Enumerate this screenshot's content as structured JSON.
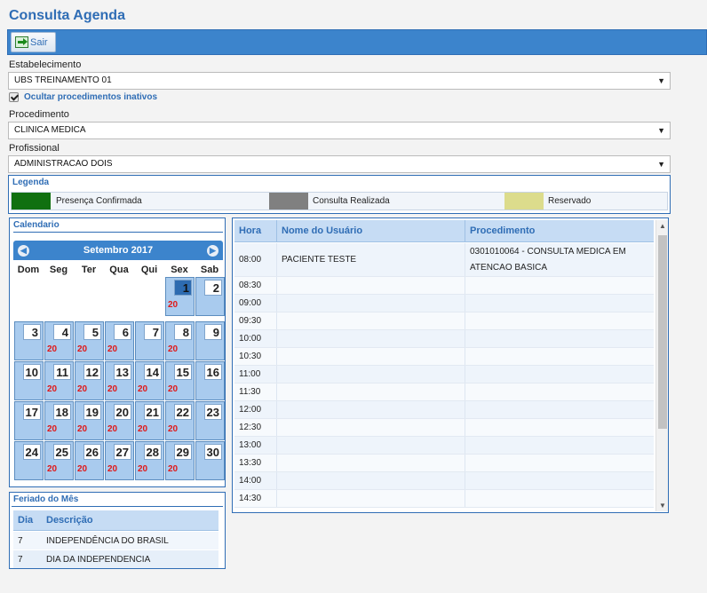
{
  "page": {
    "title": "Consulta Agenda"
  },
  "toolbar": {
    "exit_label": "Sair"
  },
  "form": {
    "establishment_label": "Estabelecimento",
    "establishment_value": "UBS TREINAMENTO 01",
    "hide_inactive_label": "Ocultar procedimentos inativos",
    "procedure_label": "Procedimento",
    "procedure_value": "CLINICA MEDICA",
    "professional_label": "Profissional",
    "professional_value": "ADMINISTRACAO DOIS"
  },
  "legend": {
    "title": "Legenda",
    "items": [
      {
        "label": "Presença Confirmada",
        "color": "#107010"
      },
      {
        "label": "Consulta Realizada",
        "color": "#808080"
      },
      {
        "label": "Reservado",
        "color": "#dcdc8c"
      }
    ]
  },
  "calendar": {
    "title": "Calendario",
    "month_label": "Setembro 2017",
    "weekdays": [
      "Dom",
      "Seg",
      "Ter",
      "Qua",
      "Qui",
      "Sex",
      "Sab"
    ],
    "selected_day": "1",
    "weeks": [
      [
        null,
        null,
        null,
        null,
        null,
        {
          "day": "1",
          "count": "20"
        },
        {
          "day": "2",
          "count": ""
        }
      ],
      [
        {
          "day": "3",
          "count": ""
        },
        {
          "day": "4",
          "count": "20"
        },
        {
          "day": "5",
          "count": "20"
        },
        {
          "day": "6",
          "count": "20"
        },
        {
          "day": "7",
          "count": ""
        },
        {
          "day": "8",
          "count": "20"
        },
        {
          "day": "9",
          "count": ""
        }
      ],
      [
        {
          "day": "10",
          "count": ""
        },
        {
          "day": "11",
          "count": "20"
        },
        {
          "day": "12",
          "count": "20"
        },
        {
          "day": "13",
          "count": "20"
        },
        {
          "day": "14",
          "count": "20"
        },
        {
          "day": "15",
          "count": "20"
        },
        {
          "day": "16",
          "count": ""
        }
      ],
      [
        {
          "day": "17",
          "count": ""
        },
        {
          "day": "18",
          "count": "20"
        },
        {
          "day": "19",
          "count": "20"
        },
        {
          "day": "20",
          "count": "20"
        },
        {
          "day": "21",
          "count": "20"
        },
        {
          "day": "22",
          "count": "20"
        },
        {
          "day": "23",
          "count": ""
        }
      ],
      [
        {
          "day": "24",
          "count": ""
        },
        {
          "day": "25",
          "count": "20"
        },
        {
          "day": "26",
          "count": "20"
        },
        {
          "day": "27",
          "count": "20"
        },
        {
          "day": "28",
          "count": "20"
        },
        {
          "day": "29",
          "count": "20"
        },
        {
          "day": "30",
          "count": ""
        }
      ]
    ]
  },
  "holidays": {
    "title": "Feriado do Mês",
    "columns": [
      "Dia",
      "Descrição"
    ],
    "rows": [
      {
        "day": "7",
        "description": "INDEPENDÊNCIA DO BRASIL"
      },
      {
        "day": "7",
        "description": "DIA DA INDEPENDENCIA"
      }
    ]
  },
  "agenda": {
    "columns": [
      "Hora",
      "Nome do Usuário",
      "Procedimento"
    ],
    "rows": [
      {
        "time": "08:00",
        "user": "PACIENTE TESTE",
        "procedure": "0301010064 - CONSULTA MEDICA EM ATENCAO BASICA"
      },
      {
        "time": "08:30",
        "user": "",
        "procedure": ""
      },
      {
        "time": "09:00",
        "user": "",
        "procedure": ""
      },
      {
        "time": "09:30",
        "user": "",
        "procedure": ""
      },
      {
        "time": "10:00",
        "user": "",
        "procedure": ""
      },
      {
        "time": "10:30",
        "user": "",
        "procedure": ""
      },
      {
        "time": "11:00",
        "user": "",
        "procedure": ""
      },
      {
        "time": "11:30",
        "user": "",
        "procedure": ""
      },
      {
        "time": "12:00",
        "user": "",
        "procedure": ""
      },
      {
        "time": "12:30",
        "user": "",
        "procedure": ""
      },
      {
        "time": "13:00",
        "user": "",
        "procedure": ""
      },
      {
        "time": "13:30",
        "user": "",
        "procedure": ""
      },
      {
        "time": "14:00",
        "user": "",
        "procedure": ""
      },
      {
        "time": "14:30",
        "user": "",
        "procedure": ""
      }
    ]
  }
}
